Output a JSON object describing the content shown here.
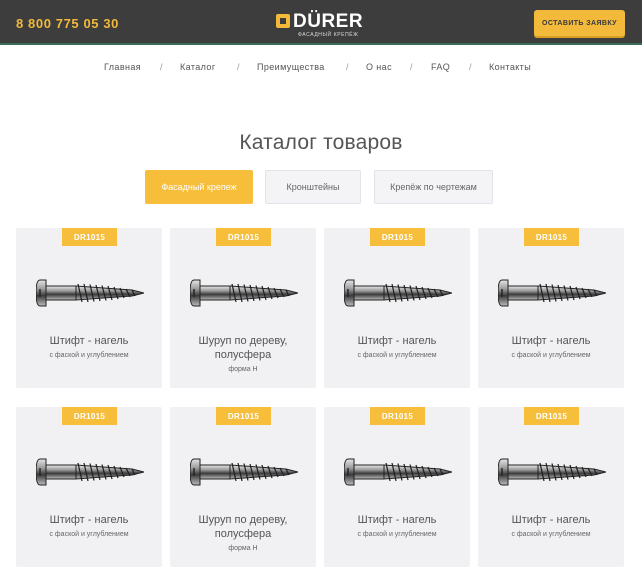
{
  "header": {
    "phone": "8 800 775 05 30",
    "logo_text": "DÜRER",
    "logo_sub": "фасадный крепёж",
    "cta_label": "ОСТАВИТЬ ЗАЯВКУ"
  },
  "nav": {
    "items": [
      "Главная",
      "Каталог",
      "Преимущества",
      "О нас",
      "FAQ",
      "Контакты"
    ],
    "separator": "/"
  },
  "catalog": {
    "title": "Каталог товаров",
    "tabs": [
      "Фасадный крепеж",
      "Кронштейны",
      "Крепёж по чертежам"
    ],
    "active_tab": "Фасадный крепеж"
  },
  "products": [
    {
      "badge": "DR1015",
      "title": "Штифт - нагель",
      "subtitle": "с фаской и углублением"
    },
    {
      "badge": "DR1015",
      "title": "Шуруп по дереву, полусфера",
      "subtitle": "форма Н"
    },
    {
      "badge": "DR1015",
      "title": "Штифт - нагель",
      "subtitle": "с фаской и углублением"
    },
    {
      "badge": "DR1015",
      "title": "Штифт - нагель",
      "subtitle": "с фаской и углублением"
    },
    {
      "badge": "DR1015",
      "title": "Штифт - нагель",
      "subtitle": "с фаской и углублением"
    },
    {
      "badge": "DR1015",
      "title": "Шуруп по дереву, полусфера",
      "subtitle": "форма Н"
    },
    {
      "badge": "DR1015",
      "title": "Штифт - нагель",
      "subtitle": "с фаской и углублением"
    },
    {
      "badge": "DR1015",
      "title": "Штифт - нагель",
      "subtitle": "с фаской и углублением"
    }
  ],
  "colors": {
    "accent": "#f7be3c",
    "header_bg": "#3d3d3d",
    "card_bg": "#f1f1f4"
  }
}
